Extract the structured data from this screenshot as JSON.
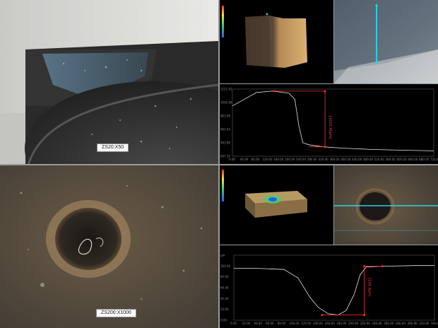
{
  "micrograph_top": {
    "label": "ZS20:X50"
  },
  "micrograph_bottom": {
    "label": "ZS200:X1000"
  },
  "profile_top": {
    "measure_label": "[1022.40μm]",
    "y_ticks": [
      "1121.61",
      "1005.96",
      "803.09",
      "601.64",
      "493.80",
      "847.30"
    ],
    "x_ticks": [
      "0.00",
      "40.00",
      "80.00",
      "120.00",
      "160.00",
      "200.00",
      "240.00",
      "280.00",
      "320.00",
      "360.00",
      "400.00",
      "440.00",
      "480.00",
      "520.00",
      "560.00",
      "600.00",
      "640.00",
      "680.00",
      "720.00"
    ]
  },
  "profile_bottom": {
    "measure_label": "[104.4μm]",
    "y_ticks": [
      "μm",
      "100.00",
      "80.00",
      "60.00",
      "40.00",
      "20.00",
      "0.00"
    ],
    "x_ticks": [
      "0.00",
      "20.00",
      "40.00",
      "60.00",
      "80.00",
      "100.00",
      "120.00",
      "140.00",
      "160.00",
      "180.00",
      "200.00",
      "220.00",
      "240.00",
      "260.00",
      "280.00",
      "300.00",
      "320.00",
      "340.00"
    ]
  },
  "colors": {
    "profile_line": "#e6e6e6",
    "measure": "#ff3030",
    "scanline": "#27d3e6"
  }
}
